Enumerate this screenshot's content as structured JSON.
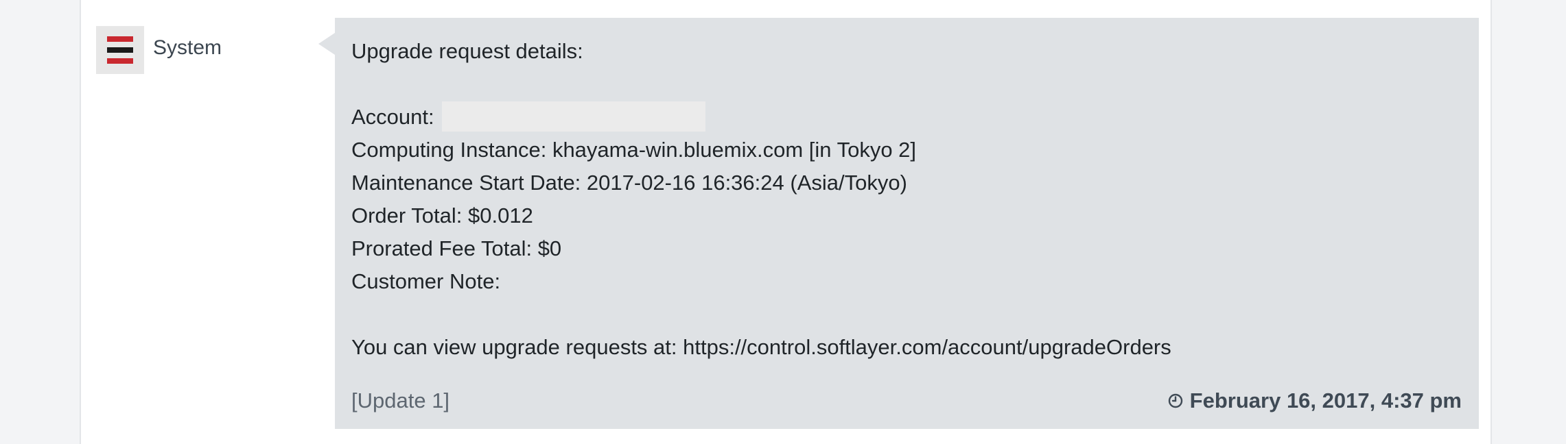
{
  "author": {
    "name": "System",
    "avatar_icon": "system-stripes-icon"
  },
  "message": {
    "heading": "Upgrade request details:",
    "account_label": "Account:",
    "account_value": "",
    "computing_instance": "Computing Instance: khayama-win.bluemix.com [in Tokyo 2]",
    "maintenance_start": "Maintenance Start Date: 2017-02-16 16:36:24 (Asia/Tokyo)",
    "order_total": "Order Total: $0.012",
    "prorated_fee": "Prorated Fee Total: $0",
    "customer_note": "Customer Note:",
    "view_link_text": "You can view upgrade requests at: https://control.softlayer.com/account/upgradeOrders"
  },
  "footer": {
    "update_label": "[Update 1]",
    "timestamp": "February 16, 2017, 4:37 pm",
    "timestamp_icon": "clock-icon"
  },
  "colors": {
    "bubble_bg": "#dfe2e5",
    "avatar_red": "#c9282f",
    "avatar_black": "#1a1a1a"
  }
}
